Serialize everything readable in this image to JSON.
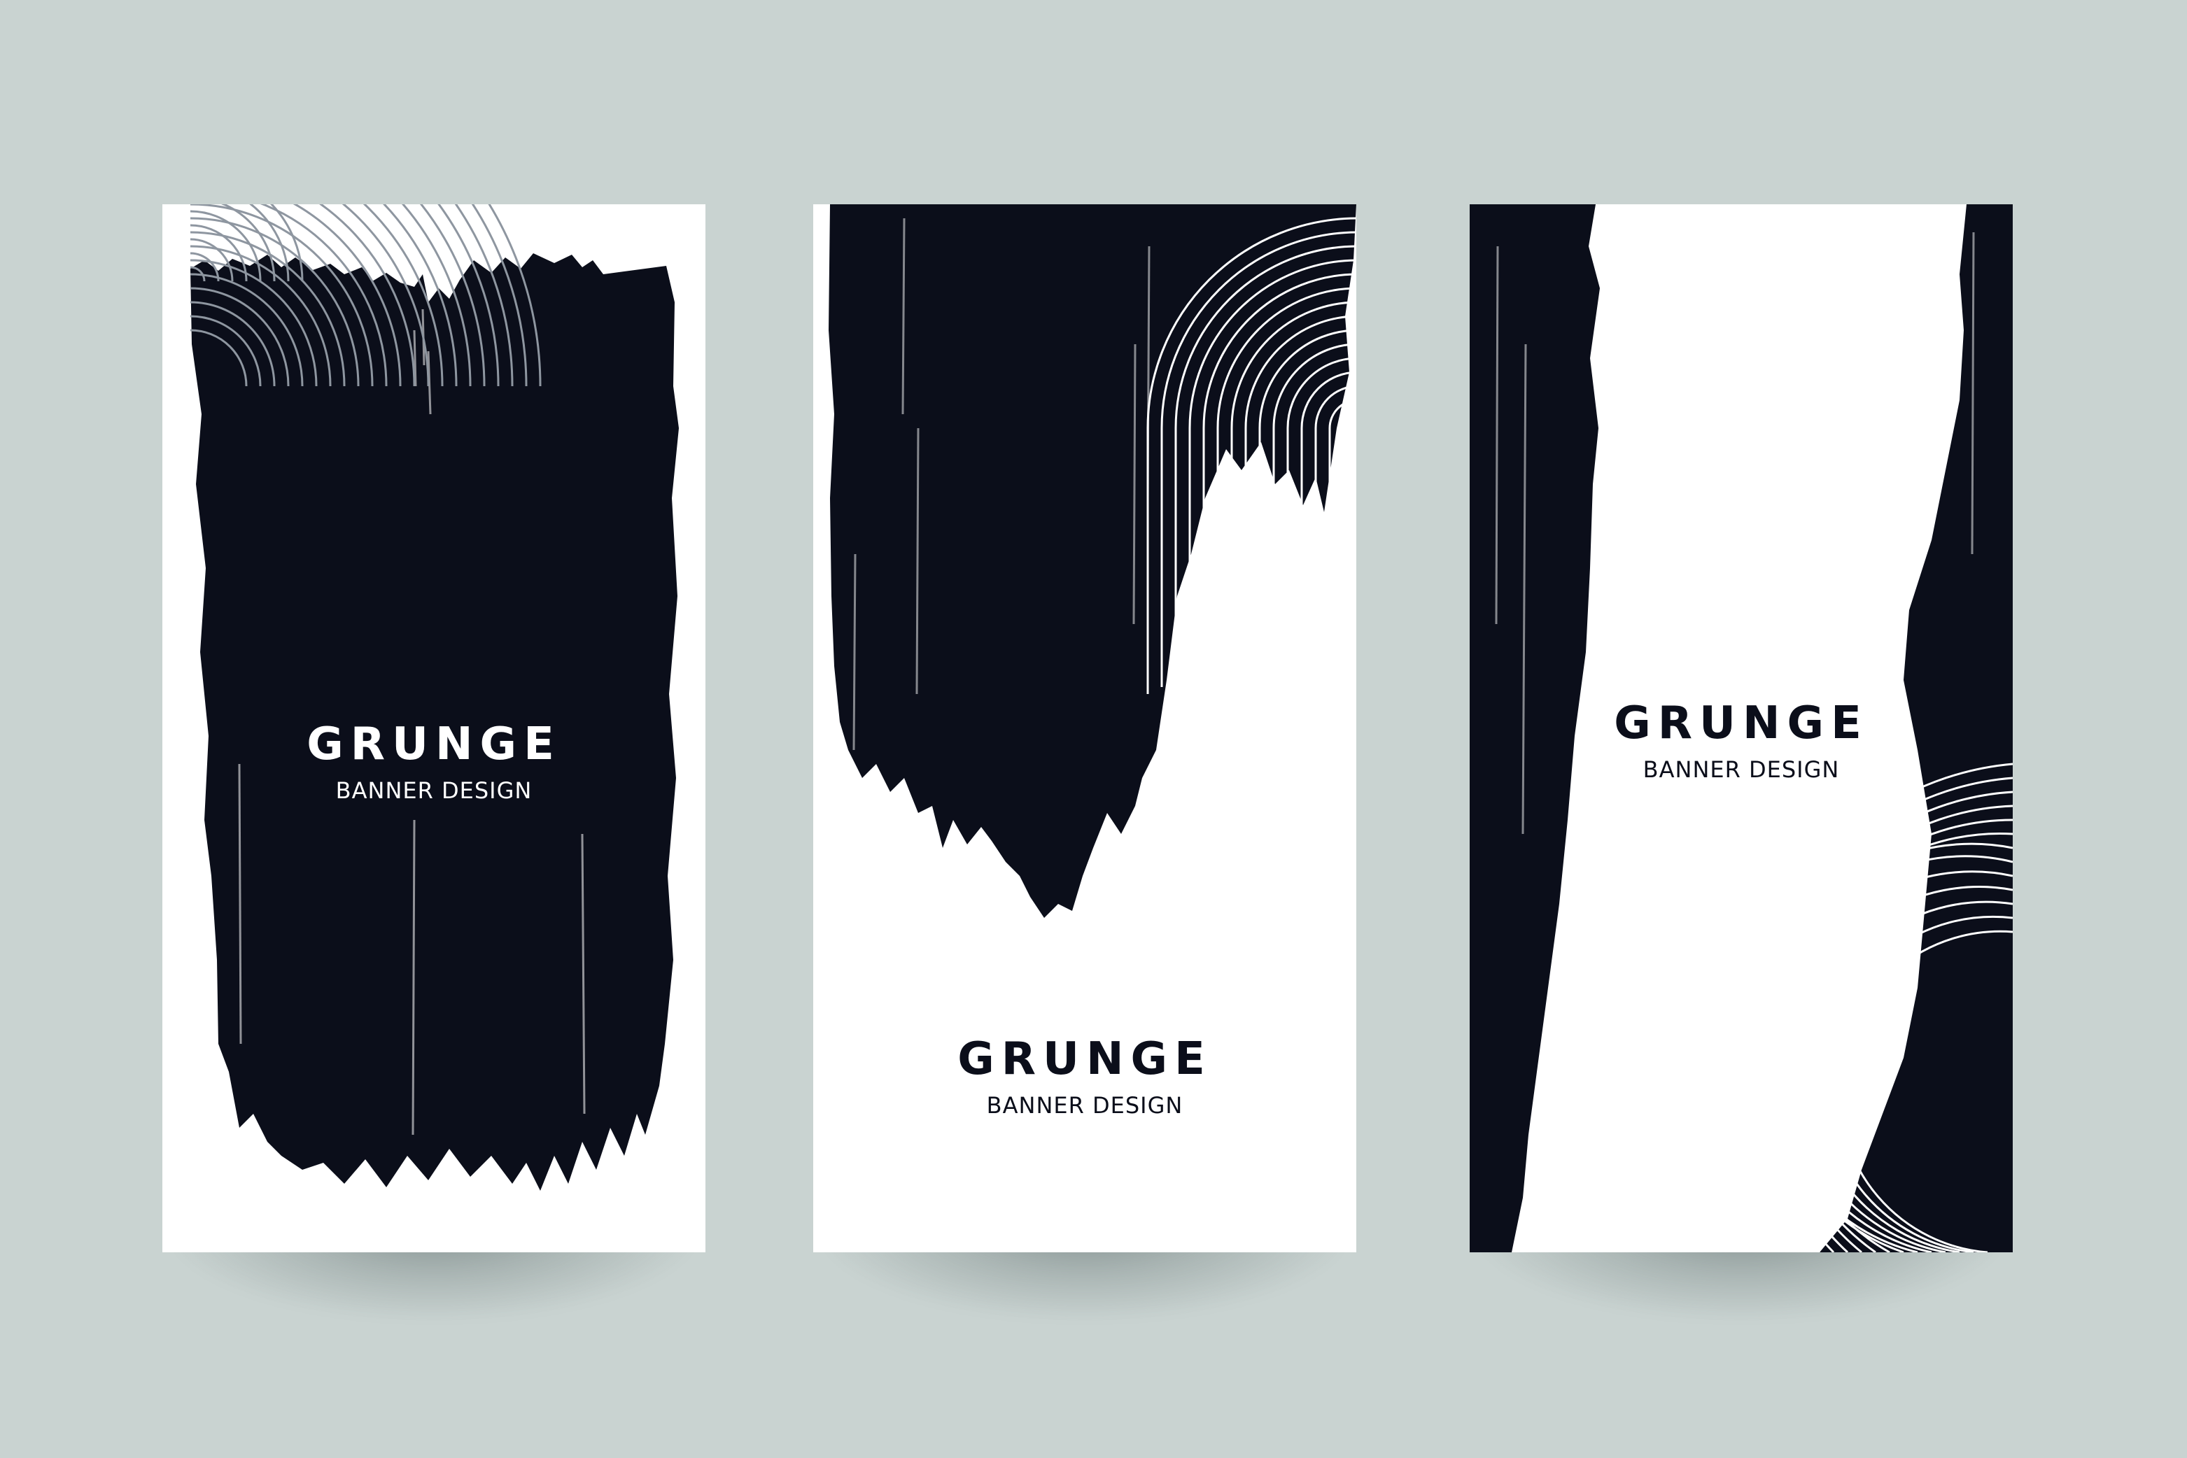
{
  "theme": {
    "background": "#c9d3d1",
    "ink": "#0b0e1a",
    "paper": "#ffffff",
    "line_light": "#8e96a0"
  },
  "banners": [
    {
      "title": "GRUNGE",
      "subtitle": "BANNER DESIGN",
      "text_color": "#ffffff",
      "style": "full-brush-block"
    },
    {
      "title": "GRUNGE",
      "subtitle": "BANNER DESIGN",
      "text_color": "#0b0e1a",
      "style": "top-brush-block"
    },
    {
      "title": "GRUNGE",
      "subtitle": "BANNER DESIGN",
      "text_color": "#0b0e1a",
      "style": "side-brush-strips"
    }
  ]
}
